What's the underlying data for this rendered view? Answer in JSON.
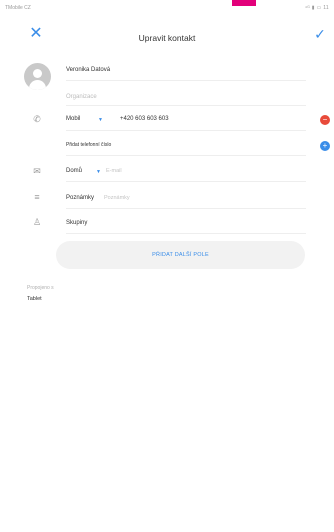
{
  "status_bar": {
    "carrier": "TMobile CZ",
    "indicators": "⁴ᴳ ▮ ▭ 11"
  },
  "header": {
    "close_icon": "close-icon",
    "title": "Upravit kontakt",
    "confirm_icon": "check-icon"
  },
  "contact": {
    "name": "Veronika Datová",
    "organization_placeholder": "Organizace"
  },
  "phone": {
    "type": "Mobil",
    "number": "+420 603 603 603",
    "add_label": "Přidat telefonní číslo"
  },
  "email": {
    "type": "Domů",
    "placeholder": "E-mail"
  },
  "notes": {
    "label": "Poznámky",
    "placeholder": "Poznámky"
  },
  "groups": {
    "label": "Skupiny"
  },
  "add_field_button": "PŘIDAT DALŠÍ POLE",
  "linked": {
    "label": "Propojeno s",
    "value": "Tablet"
  },
  "colors": {
    "accent": "#3a8de8",
    "remove": "#e84a3a",
    "brand": "#e2007a"
  }
}
